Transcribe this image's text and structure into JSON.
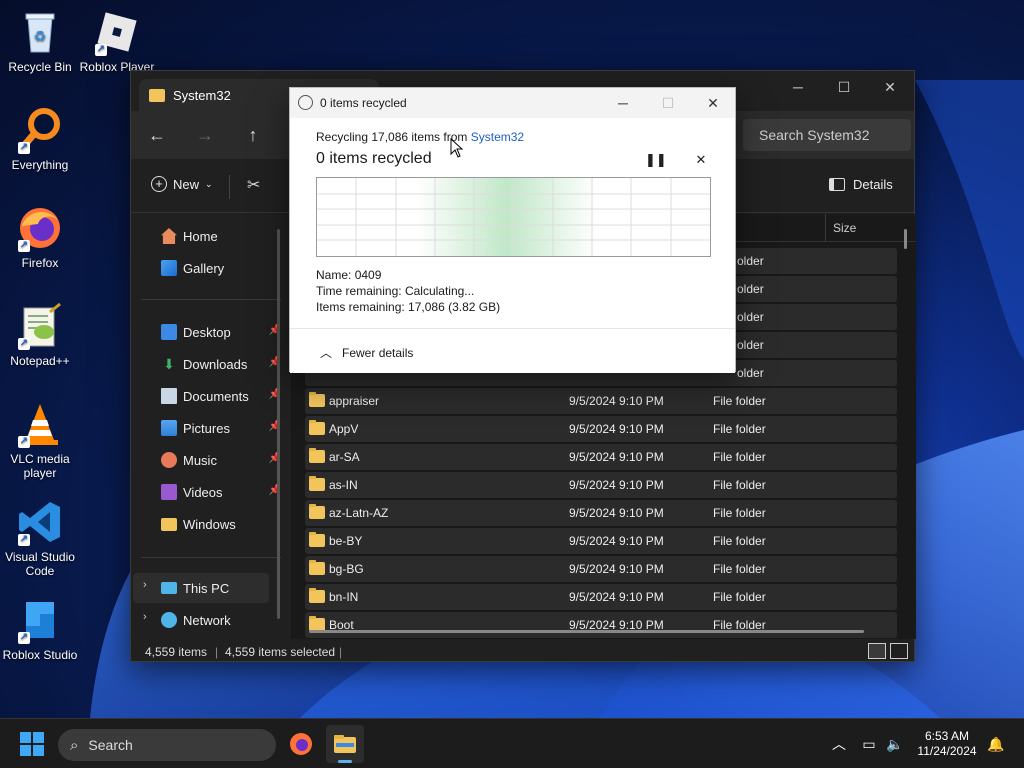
{
  "desktop": {
    "icons": [
      {
        "label": "Recycle Bin"
      },
      {
        "label": "Roblox Player"
      },
      {
        "label": "Everything"
      },
      {
        "label": "Firefox"
      },
      {
        "label": "Notepad++"
      },
      {
        "label": "VLC media player"
      },
      {
        "label": "Visual Studio Code"
      },
      {
        "label": "Roblox Studio"
      }
    ]
  },
  "explorer": {
    "tab_title": "System32",
    "search_placeholder": "Search System32",
    "toolbar": {
      "new_label": "New",
      "details_label": "Details"
    },
    "nav": {
      "home": "Home",
      "gallery": "Gallery",
      "desktop": "Desktop",
      "downloads": "Downloads",
      "documents": "Documents",
      "pictures": "Pictures",
      "music": "Music",
      "videos": "Videos",
      "windows": "Windows",
      "this_pc": "This PC",
      "network": "Network"
    },
    "columns": {
      "size": "Size"
    },
    "partial_rows": [
      {
        "type": "older"
      },
      {
        "type": "older"
      },
      {
        "type": "older"
      },
      {
        "type": "older"
      },
      {
        "type": "older"
      }
    ],
    "rows": [
      {
        "name": "appraiser",
        "date": "9/5/2024 9:10 PM",
        "type": "File folder"
      },
      {
        "name": "AppV",
        "date": "9/5/2024 9:10 PM",
        "type": "File folder"
      },
      {
        "name": "ar-SA",
        "date": "9/5/2024 9:10 PM",
        "type": "File folder"
      },
      {
        "name": "as-IN",
        "date": "9/5/2024 9:10 PM",
        "type": "File folder"
      },
      {
        "name": "az-Latn-AZ",
        "date": "9/5/2024 9:10 PM",
        "type": "File folder"
      },
      {
        "name": "be-BY",
        "date": "9/5/2024 9:10 PM",
        "type": "File folder"
      },
      {
        "name": "bg-BG",
        "date": "9/5/2024 9:10 PM",
        "type": "File folder"
      },
      {
        "name": "bn-IN",
        "date": "9/5/2024 9:10 PM",
        "type": "File folder"
      },
      {
        "name": "Boot",
        "date": "9/5/2024 9:10 PM",
        "type": "File folder"
      }
    ],
    "status": {
      "items": "4,559 items",
      "selected": "4,559 items selected"
    }
  },
  "dialog": {
    "title": "0 items recycled",
    "subtitle_prefix": "Recycling 17,086 items from ",
    "subtitle_link": "System32",
    "heading": "0 items recycled",
    "name_label": "Name:",
    "name_value": "0409",
    "time_label": "Time remaining:",
    "time_value": "Calculating...",
    "items_label": "Items remaining:",
    "items_value": "17,086 (3.82 GB)",
    "fewer_details": "Fewer details"
  },
  "taskbar": {
    "search_label": "Search",
    "time": "6:53 AM",
    "date": "11/24/2024"
  },
  "colors": {
    "accent": "#1a5fc7",
    "folder": "#f2c55c",
    "graph_green": "#8ed49b"
  }
}
